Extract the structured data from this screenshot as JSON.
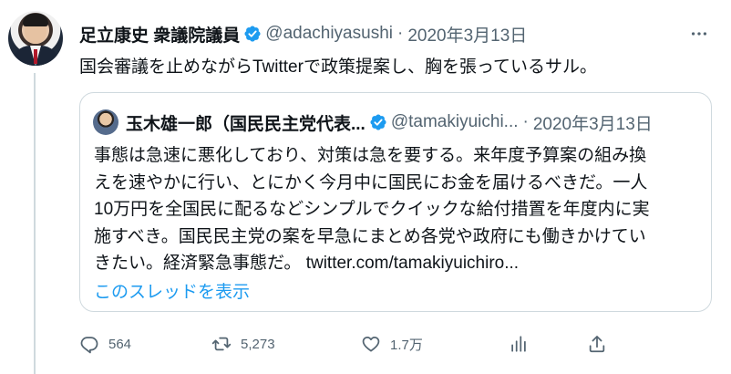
{
  "tweet": {
    "author_name": "足立康史 衆議院議員",
    "handle": "@adachiyasushi",
    "separator": "·",
    "date": "2020年3月13日",
    "more_icon": "more-horizontal-icon",
    "text": "国会審議を止めながらTwitterで政策提案し、胸を張っているサル。",
    "verified_color": "#1d9bf0"
  },
  "quote": {
    "author_name": "玉木雄一郎（国民民主党代表...",
    "handle": "@tamakiyuichi...",
    "separator": "·",
    "date": "2020年3月13日",
    "lines": [
      "事態は急速に悪化しており、対策は急を要する。来年度予算案の組み換",
      "えを速やかに行い、とにかく今月中に国民にお金を届けるべきだ。一人",
      "10万円を全国民に配るなどシンプルでクイックな給付措置を年度内に実",
      "施すべき。国民民主党の案を早急にまとめ各党や政府にも働きかけてい",
      "きたい。経済緊急事態だ。 twitter.com/tamakiyuichiro..."
    ],
    "show_thread": "このスレッドを表示",
    "link_color": "#1d9bf0"
  },
  "actions": {
    "reply_count": "564",
    "retweet_count": "5,273",
    "like_count": "1.7万",
    "icons": [
      "reply-icon",
      "retweet-icon",
      "like-icon",
      "analytics-icon",
      "share-icon"
    ]
  }
}
